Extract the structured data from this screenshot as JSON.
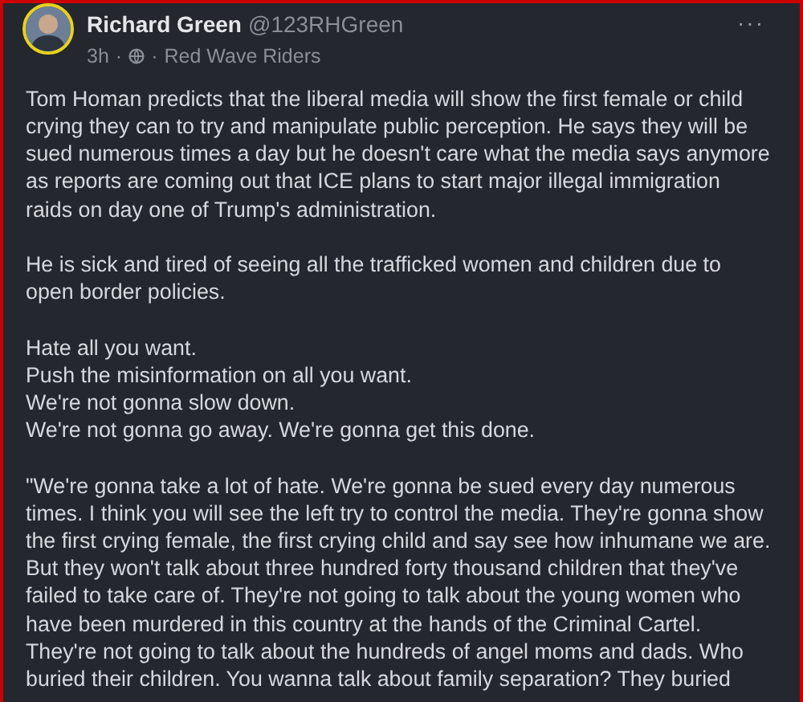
{
  "post": {
    "author": {
      "name": "Richard Green",
      "handle": "@123RHGreen"
    },
    "meta": {
      "time": "3h",
      "separator": "·",
      "group": "Red Wave Riders"
    },
    "menu": "···",
    "paragraphs": [
      "Tom Homan predicts that the liberal media will show the first female or child\ncrying they can to try and manipulate public perception. He says they will be\nsued numerous times a day but he doesn't care what the media says anymore\nas reports are coming out that ICE plans to start major illegal immigration\nraids on day one of Trump's administration.",
      "He is sick and tired of seeing all the trafficked women and children due to\nopen border policies.",
      "Hate all you want.\nPush the misinformation on all you want.\nWe're not gonna slow down.\nWe're not gonna go away. We're gonna get this done.",
      "\"We're gonna take a lot of hate. We're gonna be sued every day numerous\ntimes. I think you will see the left try to control the media. They're gonna show\nthe first crying female, the first crying child and say see how inhumane we are.\nBut they won't talk about three hundred forty thousand children that they've\nfailed to take care of. They're not going to talk about the young women who\nhave been murdered in this country at the hands of the Criminal Cartel.\nThey're not going to talk about the hundreds of angel moms and dads. Who\nburied their children. You wanna talk about family separation? They buried"
    ]
  }
}
